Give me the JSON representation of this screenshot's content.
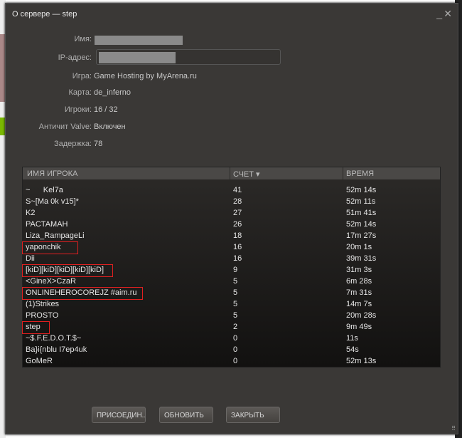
{
  "window": {
    "title": "О сервере — step",
    "minimize": "_",
    "close": "✕"
  },
  "info": [
    {
      "label": "Имя:",
      "value": ""
    },
    {
      "label": "IP-адрес:",
      "value": ""
    },
    {
      "label": "Игра:",
      "value": "Game Hosting by MyArena.ru"
    },
    {
      "label": "Карта:",
      "value": "de_inferno"
    },
    {
      "label": "Игроки:",
      "value": "16 / 32"
    },
    {
      "label": "Античит Valve:",
      "value": "Включен"
    },
    {
      "label": "Задержка:",
      "value": "78"
    }
  ],
  "table": {
    "headers": {
      "name": "ИМЯ ИГРОКА",
      "score": "СЧЕТ ▾",
      "time": "ВРЕМЯ"
    },
    "rows": [
      {
        "name": "~      Kel7a",
        "score": "41",
        "time": "52m 14s"
      },
      {
        "name": "S~[Ma 0k v15]*",
        "score": "28",
        "time": "52m 11s"
      },
      {
        "name": "K2",
        "score": "27",
        "time": "51m 41s"
      },
      {
        "name": "PACTAMAH",
        "score": "26",
        "time": "52m 14s"
      },
      {
        "name": "Liza_RampageLi",
        "score": "18",
        "time": "17m 27s"
      },
      {
        "name": "yaponchik",
        "score": "16",
        "time": "20m 1s",
        "highlight": true
      },
      {
        "name": "Dii",
        "score": "16",
        "time": "39m 31s"
      },
      {
        "name": "[kiD][kiD][kiD][kiD][kiD]",
        "score": "9",
        "time": "31m 3s",
        "highlight": true
      },
      {
        "name": "<GineX>CzaR",
        "score": "5",
        "time": "6m 28s"
      },
      {
        "name": "ONLINEHEROCOREJZ #aim.ru",
        "score": "5",
        "time": "7m 31s",
        "highlight": true
      },
      {
        "name": "(1)Strikes",
        "score": "5",
        "time": "14m 7s"
      },
      {
        "name": "PROSTO",
        "score": "5",
        "time": "20m 28s"
      },
      {
        "name": "step",
        "score": "2",
        "time": "9m 49s",
        "highlight": true
      },
      {
        "name": "~$.F.E.D.O.T.$~",
        "score": "0",
        "time": "11s"
      },
      {
        "name": "Ba}i{nblu I7ep4uk",
        "score": "0",
        "time": "54s"
      },
      {
        "name": "GoMeR",
        "score": "0",
        "time": "52m 13s"
      }
    ]
  },
  "buttons": {
    "join": "ПРИСОЕДИН...",
    "refresh": "ОБНОВИТЬ",
    "close": "ЗАКРЫТЬ"
  },
  "colors": {
    "highlight": "#e02020",
    "window": "#3a3836"
  }
}
